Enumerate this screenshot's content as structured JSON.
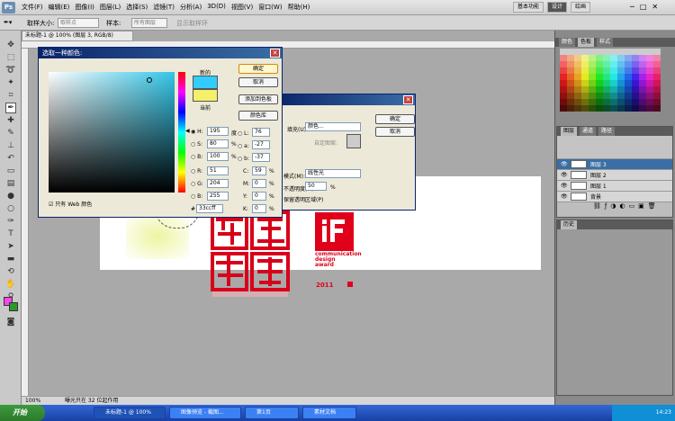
{
  "app": {
    "logo": "Ps"
  },
  "menubar": {
    "items": [
      "文件(F)",
      "编辑(E)",
      "图像(I)",
      "图层(L)",
      "选择(S)",
      "滤镜(T)",
      "分析(A)",
      "3D(D)",
      "视图(V)",
      "窗口(W)",
      "帮助(H)"
    ],
    "workspaces": [
      "基本功能",
      "设计",
      "绘画"
    ],
    "active_workspace": "设计"
  },
  "options": {
    "sample_label": "取样大小:",
    "sample_value": "取样点",
    "sample_label2": "样本:",
    "sample_value2": "所有图层",
    "show_ring": "显示取样环"
  },
  "document": {
    "tab": "未标题-1 @ 100% (图层 3, RGB/8)",
    "zoom": "100%",
    "status": "曝光只在 32 位起作用"
  },
  "picker": {
    "title": "选取一种颜色:",
    "new_label": "新的",
    "current_label": "当前",
    "ok": "确定",
    "cancel": "取消",
    "add_swatch": "添加到色板",
    "libraries": "颜色库",
    "web_only": "只有 Web 颜色",
    "H": "195",
    "H_unit": "度",
    "S": "80",
    "S_unit": "%",
    "B": "100",
    "B_unit": "%",
    "R": "51",
    "G": "204",
    "B2": "255",
    "L": "76",
    "a": "-27",
    "b": "-37",
    "C": "59",
    "M": "0",
    "Y": "0",
    "K": "0",
    "hex": "33ccff",
    "new_color": "#33ccff",
    "current_color": "#f5f06a"
  },
  "dialog2": {
    "ok": "确定",
    "cancel": "取消",
    "fill_label": "填充(U):",
    "fill_value": "颜色...",
    "custom_pattern": "自定图案:",
    "mode_label": "模式(M):",
    "mode_value": "线性光",
    "opacity_label": "不透明度(O):",
    "opacity_value": "50",
    "opacity_unit": "%",
    "preserve": "保留透明区域(P)"
  },
  "canvas": {
    "if_lines": [
      "communication",
      "design",
      "award"
    ],
    "year": "2011"
  },
  "panels": {
    "swatch_tabs": [
      "颜色",
      "色板",
      "样式"
    ],
    "layers_tabs": [
      "图层",
      "通道",
      "路径"
    ],
    "layers": [
      {
        "name": "图层 3",
        "selected": true
      },
      {
        "name": "图层 2",
        "selected": false
      },
      {
        "name": "图层 1",
        "selected": false
      },
      {
        "name": "背景",
        "selected": false
      }
    ],
    "history_tab": "历史"
  },
  "taskbar": {
    "start": "开始",
    "tasks": [
      "未标题-1 @ 100%",
      "图像预览 - 截图...",
      "第1页",
      "素材文档"
    ],
    "clock": "14:23"
  },
  "colors": {
    "accent": "#3a6ea5",
    "logo_red": "#e0001a"
  }
}
